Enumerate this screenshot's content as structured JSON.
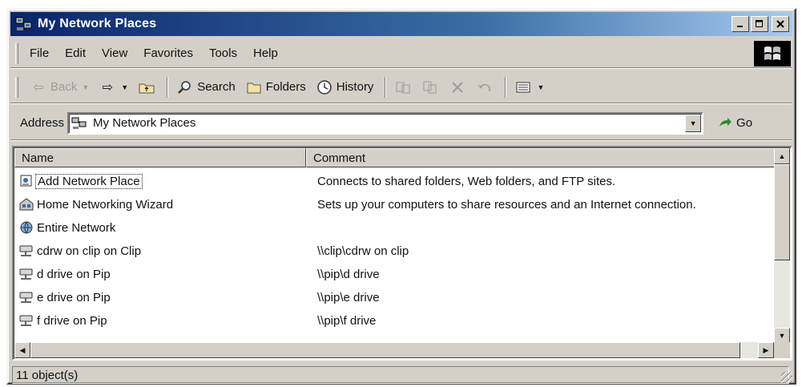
{
  "window": {
    "title": "My Network Places"
  },
  "menubar": {
    "items": [
      "File",
      "Edit",
      "View",
      "Favorites",
      "Tools",
      "Help"
    ]
  },
  "toolbar": {
    "back": "Back",
    "search": "Search",
    "folders": "Folders",
    "history": "History"
  },
  "addressbar": {
    "label": "Address",
    "value": "My Network Places",
    "go": "Go"
  },
  "listview": {
    "columns": {
      "name": "Name",
      "comment": "Comment"
    },
    "rows": [
      {
        "name": "Add Network Place",
        "comment": "Connects to shared folders, Web folders, and FTP sites.",
        "icon": "add-network-place-icon"
      },
      {
        "name": "Home Networking Wizard",
        "comment": "Sets up your computers to share resources and an Internet connection.",
        "icon": "home-network-wizard-icon"
      },
      {
        "name": "Entire Network",
        "comment": "",
        "icon": "entire-network-icon"
      },
      {
        "name": "cdrw on clip on Clip",
        "comment": "\\\\clip\\cdrw on clip",
        "icon": "network-drive-icon"
      },
      {
        "name": "d drive on Pip",
        "comment": "\\\\pip\\d drive",
        "icon": "network-drive-icon"
      },
      {
        "name": "e drive on Pip",
        "comment": "\\\\pip\\e drive",
        "icon": "network-drive-icon"
      },
      {
        "name": "f drive on Pip",
        "comment": "\\\\pip\\f drive",
        "icon": "network-drive-icon"
      }
    ]
  },
  "statusbar": {
    "text": "11 object(s)"
  }
}
